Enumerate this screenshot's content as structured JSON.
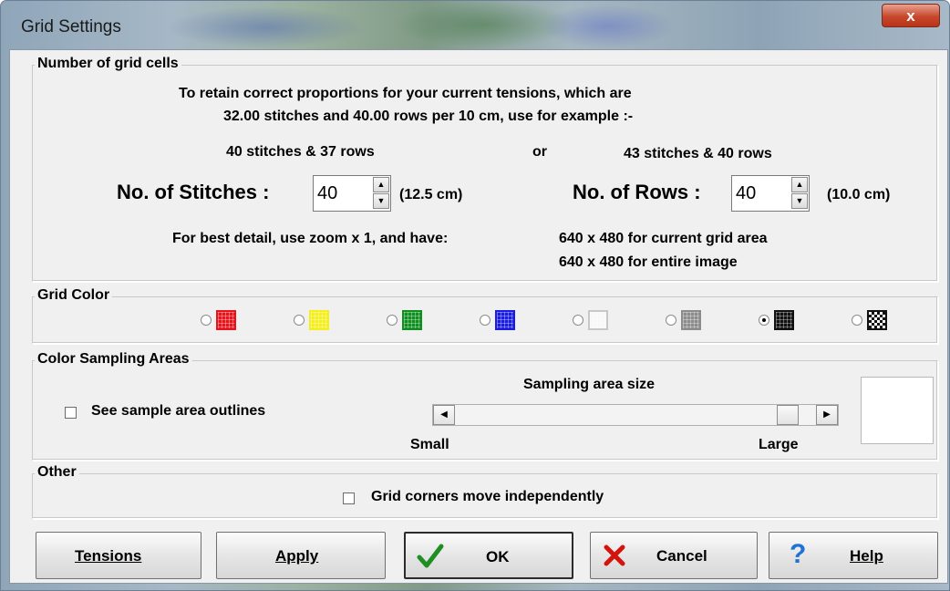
{
  "window": {
    "title": "Grid Settings",
    "close_label": "x"
  },
  "grid_cells": {
    "legend": "Number of grid cells",
    "info_line1": "To retain correct proportions for your current tensions, which are",
    "info_line2": "32.00 stitches and 40.00 rows per 10 cm, use for example :-",
    "example1": "40 stitches & 37 rows",
    "or": "or",
    "example2": "43 stitches & 40 rows",
    "stitches_label": "No. of Stitches :",
    "stitches_value": "40",
    "stitches_cm": "(12.5 cm)",
    "rows_label": "No. of Rows :",
    "rows_value": "40",
    "rows_cm": "(10.0 cm)",
    "detail_label": "For best detail, use zoom x 1, and have:",
    "detail_line1": "640 x 480 for current grid area",
    "detail_line2": "640 x 480 for entire image"
  },
  "grid_color": {
    "legend": "Grid Color",
    "selected": "black",
    "swatches": [
      {
        "name": "red",
        "color": "#e8141b"
      },
      {
        "name": "yellow",
        "color": "#f4ef1c"
      },
      {
        "name": "green",
        "color": "#0f8f1e"
      },
      {
        "name": "blue",
        "color": "#1a1ce0"
      },
      {
        "name": "white",
        "color": "#f8f8f8"
      },
      {
        "name": "gray",
        "color": "#8c8c8c"
      },
      {
        "name": "black",
        "color": "#111111"
      },
      {
        "name": "pattern",
        "color": "#222222"
      }
    ]
  },
  "sampling": {
    "legend": "Color Sampling Areas",
    "outline_label": "See sample area outlines",
    "outline_checked": false,
    "size_label": "Sampling area size",
    "min_label": "Small",
    "max_label": "Large",
    "slider_fraction": 0.95
  },
  "other": {
    "legend": "Other",
    "corners_label": "Grid corners move independently",
    "corners_checked": false
  },
  "buttons": {
    "tensions_label": "Tensions",
    "apply_label": "Apply",
    "ok_label": "OK",
    "cancel_label": "Cancel",
    "help_label": "Help"
  }
}
